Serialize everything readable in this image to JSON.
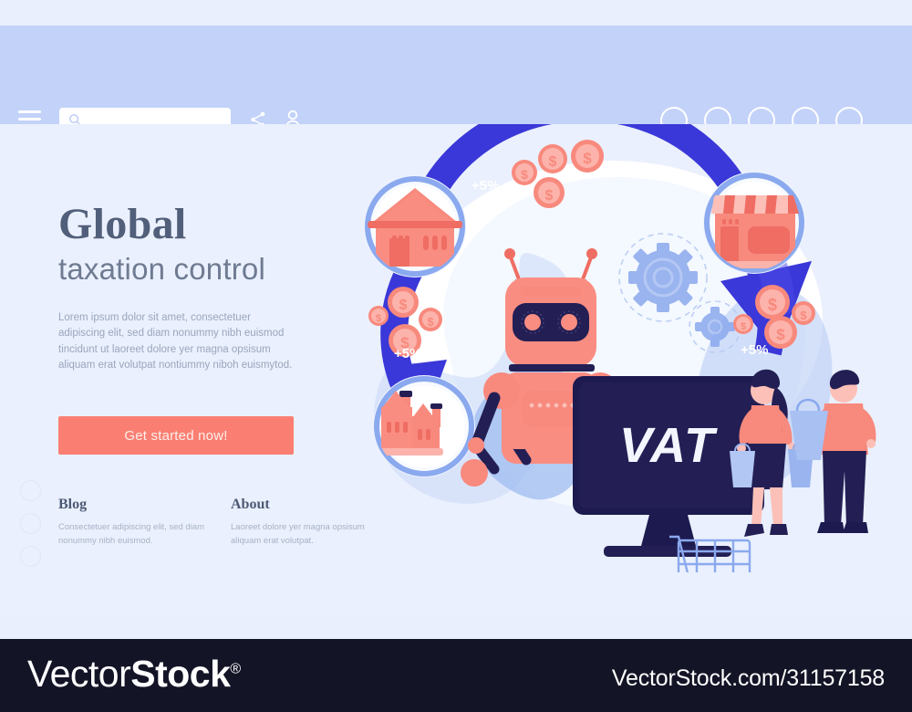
{
  "header": {
    "menu_icon": "hamburger-icon",
    "search": {
      "value": "",
      "placeholder": ""
    },
    "share_icon": "share-icon",
    "account_icon": "user-icon",
    "nav_circles": [
      "",
      "",
      "",
      "",
      ""
    ]
  },
  "hero": {
    "headline_line1": "Global",
    "headline_line2": "taxation control",
    "paragraph": "Lorem ipsum dolor sit amet, consectetuer adipiscing elit, sed diam nonummy nibh euismod tincidunt ut laoreet dolore yer magna opsisum aliquam erat volutpat nontiummy niboh euismytod.",
    "cta_label": "Get started now!"
  },
  "links": [
    {
      "title": "Blog",
      "body": "Consectetuer adipiscing elit, sed diam nonummy nibh euismod."
    },
    {
      "title": "About",
      "body": "Laoreet dolore yer magna opsisum aliquam erat volutpat."
    }
  ],
  "illustration": {
    "monitor_label": "VAT",
    "rate_badges": [
      "+5%",
      "+5%",
      "+5%"
    ],
    "coin_symbol": "$",
    "icon_nodes": [
      {
        "name": "house-icon"
      },
      {
        "name": "shop-icon"
      },
      {
        "name": "factory-icon"
      }
    ],
    "robot": "robot-character",
    "shoppers": [
      "woman-shopper",
      "man-shopper"
    ],
    "cart": "shopping-cart",
    "gears": [
      "gear-large",
      "gear-small"
    ]
  },
  "footer": {
    "logo_thin": "Vector",
    "logo_bold": "Stock",
    "logo_reg": "®",
    "url": "VectorStock.com/31157158"
  },
  "colors": {
    "coral": "#fa7f72",
    "coral_dark": "#ef6d63",
    "navy": "#231f54",
    "blue": "#3a38d8",
    "light_blue": "#a9c0f2",
    "header_bg": "#c3d2f9",
    "page_bg": "#eaf0fd",
    "footer_bg": "#131426"
  }
}
